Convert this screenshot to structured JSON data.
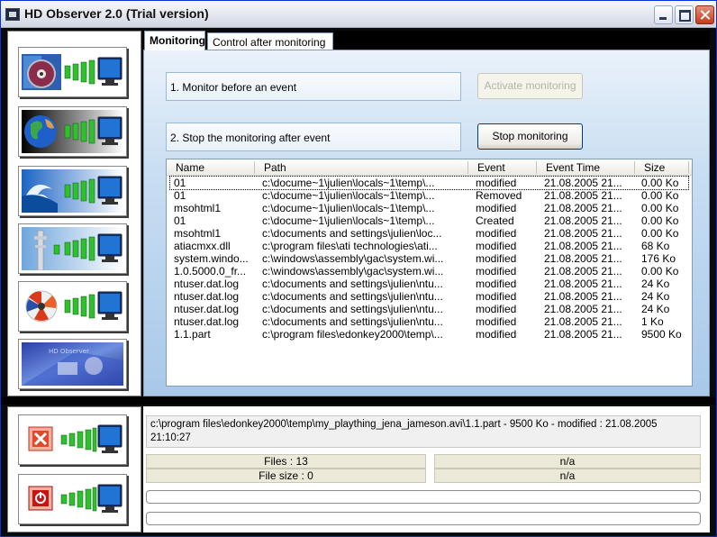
{
  "window": {
    "title": "HD Observer 2.0 (Trial version)"
  },
  "tabs": [
    {
      "label": "Monitoring"
    },
    {
      "label": "Control after monitoring"
    }
  ],
  "steps": {
    "step1": {
      "label": "1. Monitor before an event",
      "button": "Activate monitoring"
    },
    "step2": {
      "label": "2. Stop the monitoring after event",
      "button": "Stop monitoring"
    }
  },
  "table": {
    "columns": [
      "Name",
      "Path",
      "Event",
      "Event Time",
      "Size"
    ],
    "rows": [
      {
        "name": "01",
        "path": "c:\\docume~1\\julien\\locals~1\\temp\\...",
        "event": "modified",
        "time": "21.08.2005 21...",
        "size": "0.00 Ko"
      },
      {
        "name": "01",
        "path": "c:\\docume~1\\julien\\locals~1\\temp\\...",
        "event": "Removed",
        "time": "21.08.2005 21...",
        "size": "0.00 Ko"
      },
      {
        "name": "msohtml1",
        "path": "c:\\docume~1\\julien\\locals~1\\temp\\...",
        "event": "modified",
        "time": "21.08.2005 21...",
        "size": "0.00 Ko"
      },
      {
        "name": "01",
        "path": "c:\\docume~1\\julien\\locals~1\\temp\\...",
        "event": "Created",
        "time": "21.08.2005 21...",
        "size": "0.00 Ko"
      },
      {
        "name": "msohtml1",
        "path": "c:\\documents and settings\\julien\\loc...",
        "event": "modified",
        "time": "21.08.2005 21...",
        "size": "0.00 Ko"
      },
      {
        "name": "atiacmxx.dll",
        "path": "c:\\program files\\ati technologies\\ati...",
        "event": "modified",
        "time": "21.08.2005 21...",
        "size": "68 Ko"
      },
      {
        "name": "system.windo...",
        "path": "c:\\windows\\assembly\\gac\\system.wi...",
        "event": "modified",
        "time": "21.08.2005 21...",
        "size": "176 Ko"
      },
      {
        "name": "1.0.5000.0_fr...",
        "path": "c:\\windows\\assembly\\gac\\system.wi...",
        "event": "modified",
        "time": "21.08.2005 21...",
        "size": "0.00 Ko"
      },
      {
        "name": "ntuser.dat.log",
        "path": "c:\\documents and settings\\julien\\ntu...",
        "event": "modified",
        "time": "21.08.2005 21...",
        "size": "24 Ko"
      },
      {
        "name": "ntuser.dat.log",
        "path": "c:\\documents and settings\\julien\\ntu...",
        "event": "modified",
        "time": "21.08.2005 21...",
        "size": "24 Ko"
      },
      {
        "name": "ntuser.dat.log",
        "path": "c:\\documents and settings\\julien\\ntu...",
        "event": "modified",
        "time": "21.08.2005 21...",
        "size": "24 Ko"
      },
      {
        "name": "ntuser.dat.log",
        "path": "c:\\documents and settings\\julien\\ntu...",
        "event": "modified",
        "time": "21.08.2005 21...",
        "size": "1 Ko"
      },
      {
        "name": "1.1.part",
        "path": "c:\\program files\\edonkey2000\\temp\\...",
        "event": "modified",
        "time": "21.08.2005 21...",
        "size": "9500 Ko"
      }
    ]
  },
  "status": {
    "message": "c:\\program files\\edonkey2000\\temp\\my_plaything_jena_jameson.avi\\1.1.part - 9500 Ko - modified : 21.08.2005 21:10:27",
    "files": "Files : 13",
    "filesize": "File size : 0",
    "na1": "n/a",
    "na2": "n/a"
  },
  "sidebar": {
    "items": [
      {
        "icon": "cd-disc-icon"
      },
      {
        "icon": "globe-icon"
      },
      {
        "icon": "wave-icon"
      },
      {
        "icon": "antenna-tower-icon"
      },
      {
        "icon": "cpu-fan-icon"
      },
      {
        "icon": "hd-observer-logo"
      }
    ],
    "bottom_items": [
      {
        "icon": "delete-icon"
      },
      {
        "icon": "power-icon"
      }
    ]
  }
}
